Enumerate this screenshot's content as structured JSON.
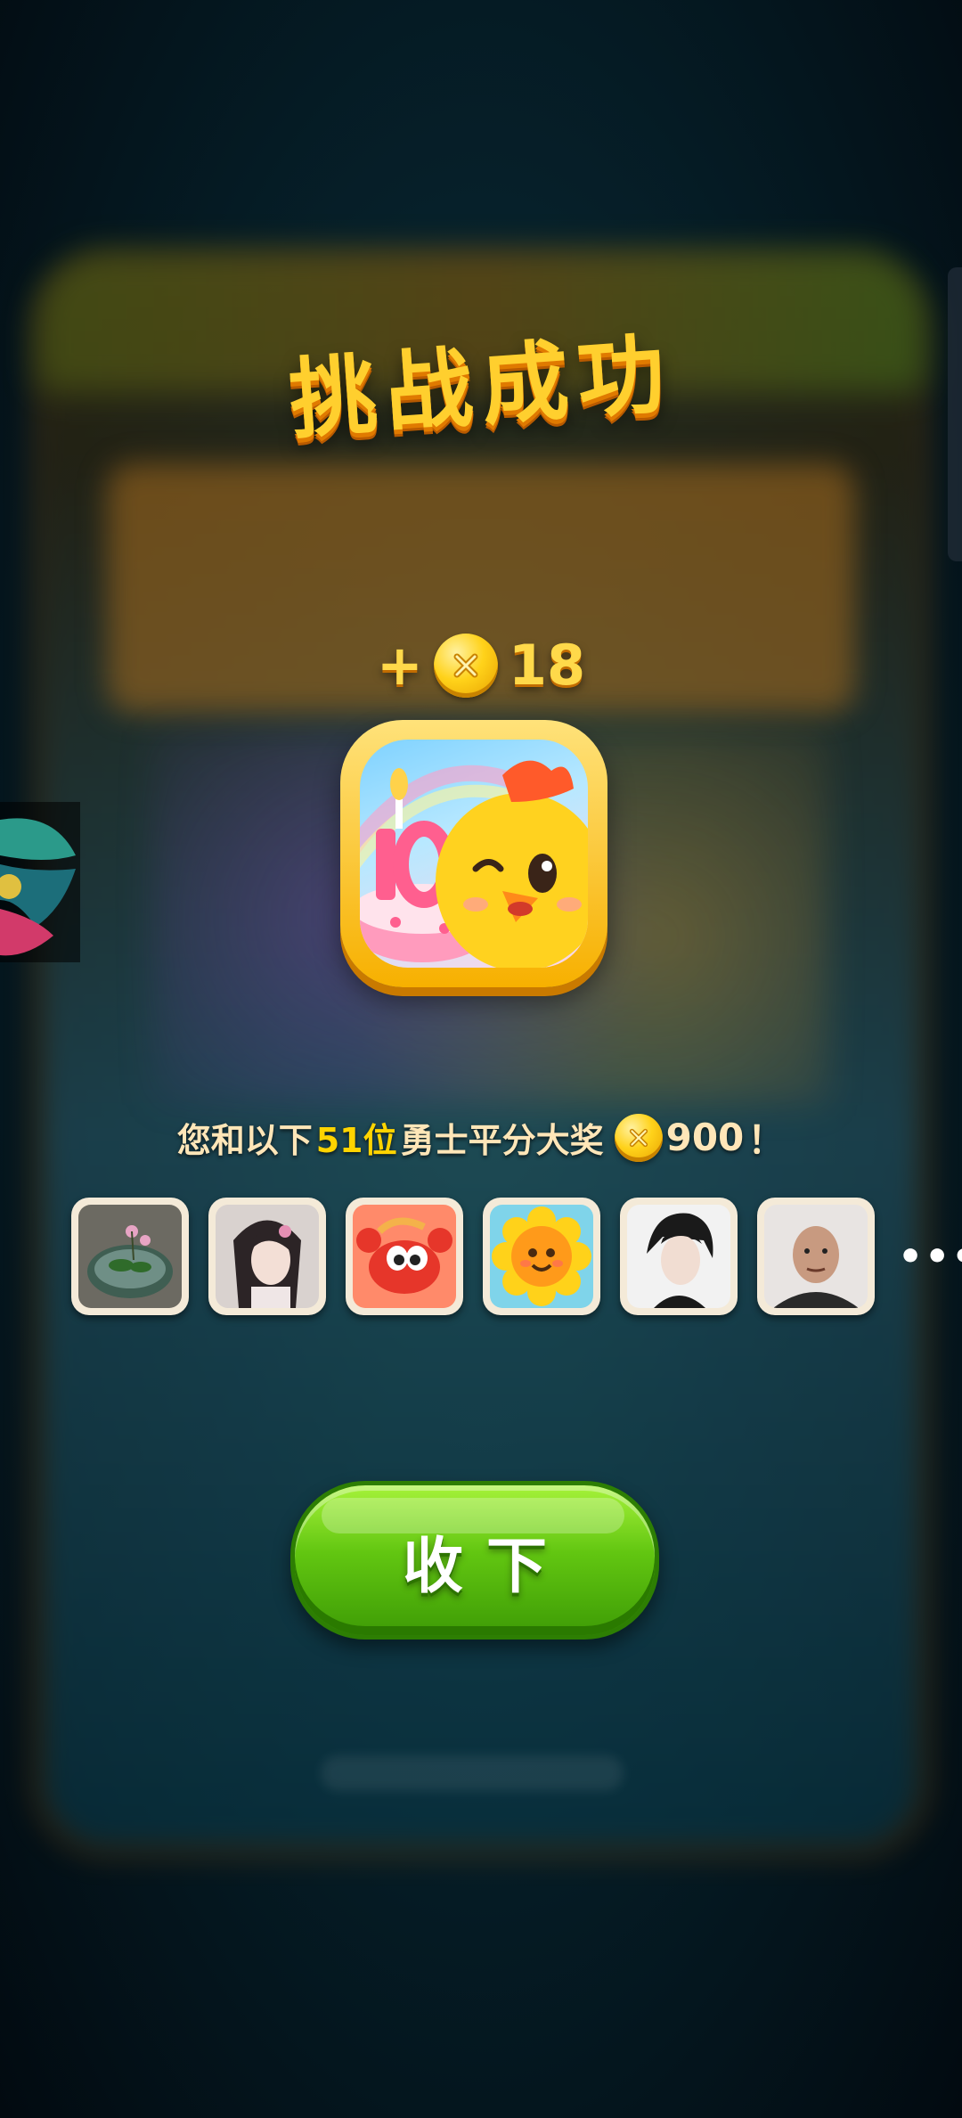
{
  "dialog": {
    "title": "挑战成功",
    "reward": {
      "plus": "+",
      "coin_icon": "gold-coin-icon",
      "amount": "18"
    },
    "app_icon": "chick-birthday-cake-icon",
    "message": {
      "prefix": "您和以下",
      "count": "51位",
      "middle": "勇士平分大奖",
      "coin_icon": "gold-coin-icon",
      "prize": "900",
      "suffix": "！"
    },
    "participants": [
      {
        "avatar": "flower-bowl-avatar"
      },
      {
        "avatar": "anime-girl-avatar"
      },
      {
        "avatar": "crab-avatar"
      },
      {
        "avatar": "sunflower-avatar"
      },
      {
        "avatar": "anime-boy-avatar"
      },
      {
        "avatar": "man-photo-avatar"
      }
    ],
    "more_label": "•••",
    "collect_button": "收下"
  },
  "colors": {
    "title": "#ffcf2e",
    "coin": "#ffd21a",
    "button": "#62c611",
    "highlight": "#ffd400"
  }
}
